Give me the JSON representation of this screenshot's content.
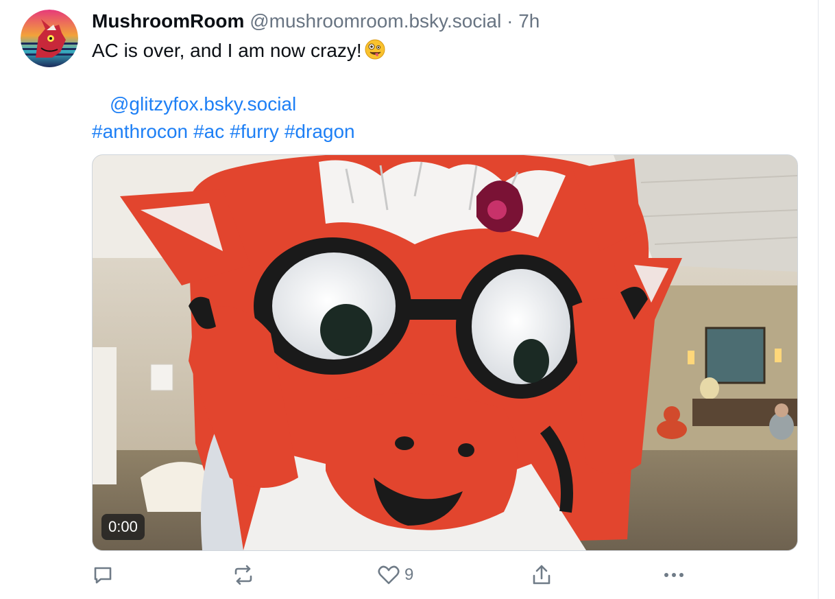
{
  "post": {
    "author": {
      "display_name": "MushroomRoom",
      "handle": "@mushroomroom.bsky.social",
      "separator": "·",
      "time_ago": "7h"
    },
    "text": "AC is over, and I am now crazy!",
    "emoji": "zany-face",
    "mention": "@glitzyfox.bsky.social",
    "hashtags": [
      "#anthrocon",
      "#ac",
      "#furry",
      "#dragon"
    ],
    "video": {
      "timestamp": "0:00",
      "description_icon": "video-thumbnail"
    },
    "actions": {
      "reply_icon": "reply-icon",
      "repost_icon": "repost-icon",
      "like_icon": "heart-icon",
      "like_count": "9",
      "share_icon": "share-icon",
      "more_icon": "more-icon"
    }
  },
  "colors": {
    "link": "#1d7ff5",
    "text": "#0b0f14",
    "muted": "#687482",
    "icon": "#6f7b87"
  }
}
